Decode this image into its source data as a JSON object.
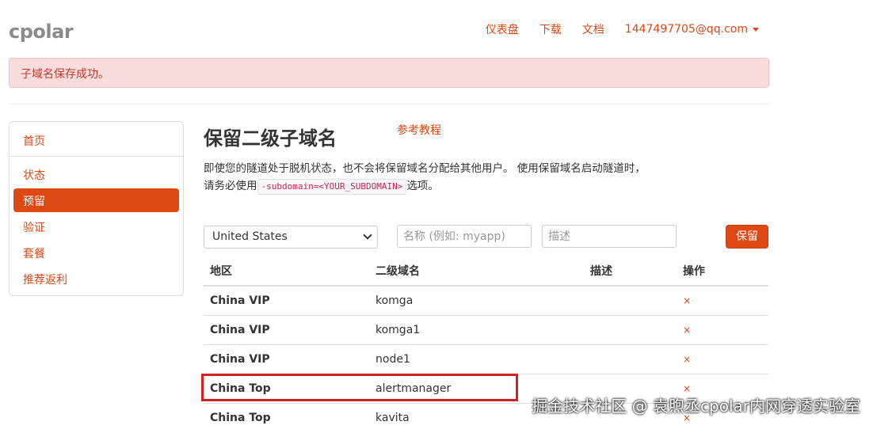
{
  "brand": {
    "logo": "cpolar"
  },
  "nav": {
    "dashboard": "仪表盘",
    "download": "下载",
    "docs": "文档",
    "account": "1447497705@qq.com"
  },
  "alert": {
    "message": "子域名保存成功。"
  },
  "sidebar": {
    "items": [
      {
        "label": "首页",
        "active": false
      },
      {
        "label": "状态",
        "active": false
      },
      {
        "label": "预留",
        "active": true
      },
      {
        "label": "验证",
        "active": false
      },
      {
        "label": "套餐",
        "active": false
      },
      {
        "label": "推荐返利",
        "active": false
      }
    ]
  },
  "main": {
    "title": "保留二级子域名",
    "tutorial_link": "参考教程",
    "description_before": "即使您的隧道处于脱机状态，也不会将保留域名分配给其他用户。 使用保留域名启动隧道时，请务必使用",
    "description_code": "-subdomain=<YOUR_SUBDOMAIN>",
    "description_after": "选项。"
  },
  "form": {
    "region_selected": "United States",
    "name_placeholder": "名称 (例如: myapp)",
    "desc_placeholder": "描述",
    "submit_label": "保留"
  },
  "table": {
    "headers": [
      "地区",
      "二级域名",
      "描述",
      "操作"
    ],
    "rows": [
      {
        "region": "China VIP",
        "subdomain": "komga",
        "description": "",
        "action": "×"
      },
      {
        "region": "China VIP",
        "subdomain": "komga1",
        "description": "",
        "action": "×"
      },
      {
        "region": "China VIP",
        "subdomain": "node1",
        "description": "",
        "action": "×"
      },
      {
        "region": "China Top",
        "subdomain": "alertmanager",
        "description": "",
        "action": "×"
      },
      {
        "region": "China Top",
        "subdomain": "kavita",
        "description": "",
        "action": "×"
      }
    ]
  },
  "watermark": "掘金技术社区 @ 袁煦丞cpolar内网穿透实验室",
  "colors": {
    "accent": "#dd4814",
    "alert_bg": "#f9dcdc",
    "highlight": "#d21f1f"
  }
}
